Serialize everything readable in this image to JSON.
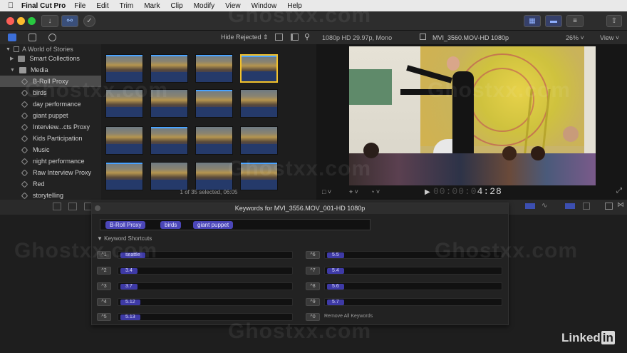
{
  "menubar": {
    "app_name": "Final Cut Pro",
    "items": [
      "File",
      "Edit",
      "Trim",
      "Mark",
      "Clip",
      "Modify",
      "View",
      "Window",
      "Help"
    ]
  },
  "browser": {
    "filter_label": "Hide Rejected",
    "library_name": "A World of Stories",
    "sidebar": {
      "smart_collections": "Smart Collections",
      "media": "Media",
      "items": [
        "B-Roll Proxy",
        "birds",
        "day performance",
        "giant puppet",
        "Interview...cts Proxy",
        "Kids Participation",
        "Music",
        "night performance",
        "Raw Interview Proxy",
        "Red",
        "storytelling"
      ],
      "selected_index": 0
    },
    "status": "1 of 35 selected, 06:05"
  },
  "viewer": {
    "format": "1080p HD 29.97p, Mono",
    "clip_name": "MVI_3560.MOV-HD 1080p",
    "zoom": "26%",
    "view_label": "View",
    "timecode": "00:00:04:28"
  },
  "keywords_hud": {
    "title": "Keywords for MVI_3556.MOV_001-HD 1080p",
    "applied": [
      "B-Roll Proxy",
      "birds",
      "giant puppet"
    ],
    "section_label": "Keyword Shortcuts",
    "shortcuts_left": [
      {
        "key": "^1",
        "value": "seattle"
      },
      {
        "key": "^2",
        "value": "3.4"
      },
      {
        "key": "^3",
        "value": "3.7"
      },
      {
        "key": "^4",
        "value": "5.12"
      },
      {
        "key": "^5",
        "value": "5.13"
      }
    ],
    "shortcuts_right": [
      {
        "key": "^6",
        "value": "5.5"
      },
      {
        "key": "^7",
        "value": "5.4"
      },
      {
        "key": "^8",
        "value": "5.6"
      },
      {
        "key": "^9",
        "value": "5.7"
      },
      {
        "key": "^0",
        "value": "Remove All Keywords"
      }
    ]
  },
  "watermark": "Ghostxx.com",
  "branding": "LinkedIn"
}
